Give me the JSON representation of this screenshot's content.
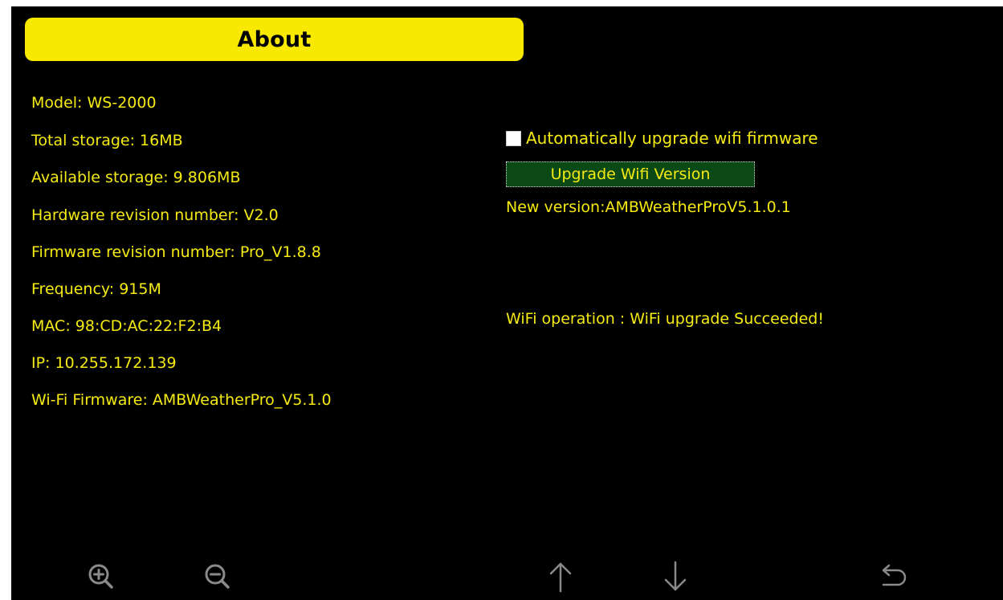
{
  "header": {
    "title": "About"
  },
  "device_info": [
    "Model: WS-2000",
    "Total storage: 16MB",
    "Available storage: 9.806MB",
    "Hardware revision number: V2.0",
    "Firmware revision number: Pro_V1.8.8",
    "Frequency: 915M",
    "MAC: 98:CD:AC:22:F2:B4",
    "IP: 10.255.172.139",
    "Wi-Fi Firmware: AMBWeatherPro_V5.1.0"
  ],
  "wifi": {
    "auto_upgrade_label": "Automatically upgrade wifi firmware",
    "auto_upgrade_checked": false,
    "upgrade_button_label": "Upgrade Wifi Version",
    "new_version_text": "New version:AMBWeatherProV5.1.0.1",
    "operation_status": "WiFi operation : WiFi upgrade Succeeded!"
  },
  "toolbar": {
    "icons": [
      "zoom-in-icon",
      "zoom-out-icon",
      "arrow-up-icon",
      "arrow-down-icon",
      "back-icon"
    ]
  },
  "colors": {
    "background": "#000000",
    "title_bar": "#f9e900",
    "text": "#f5ea12",
    "button_bg": "#0b4a16",
    "icon": "#8a8a8a"
  }
}
